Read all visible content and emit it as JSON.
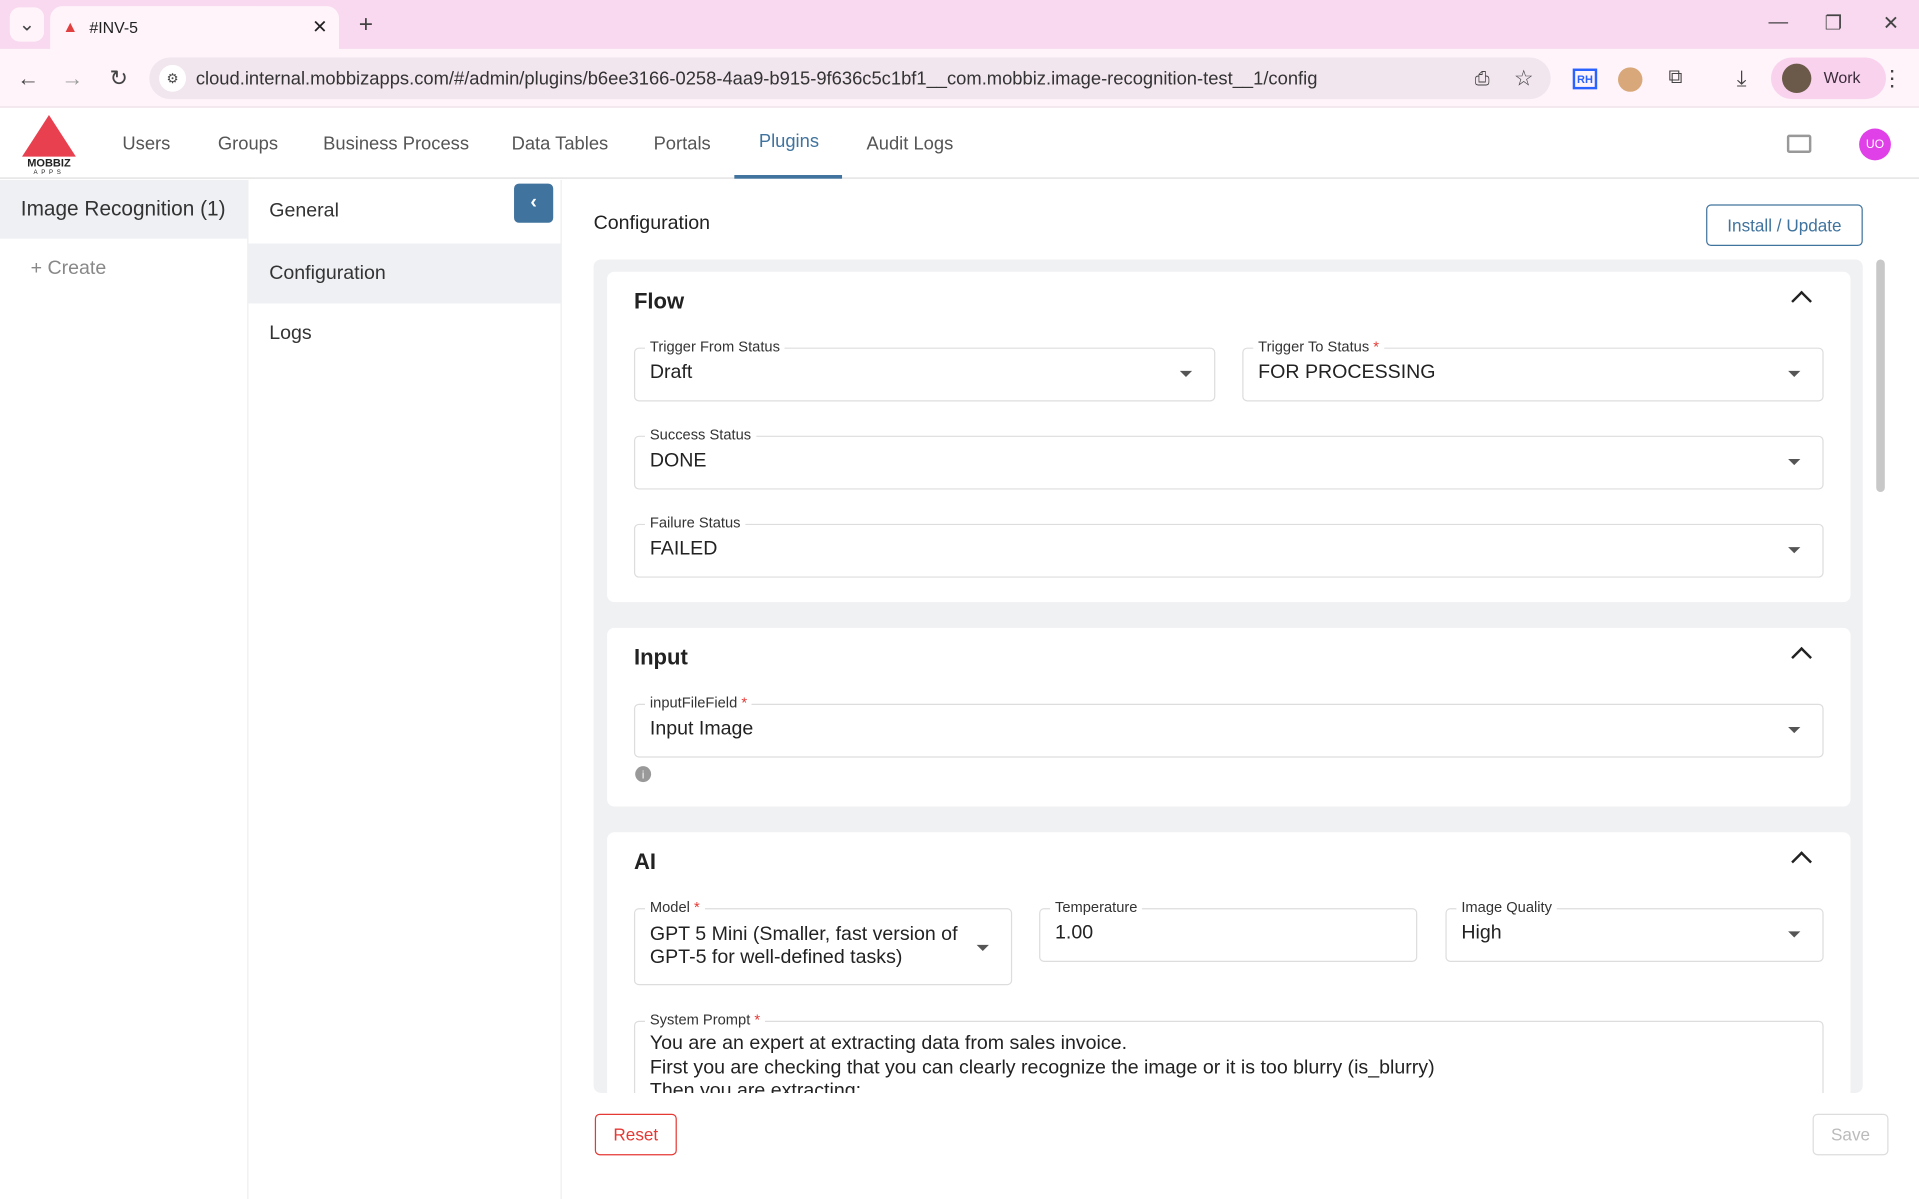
{
  "browser": {
    "tab_title": "#INV-5",
    "url": "cloud.internal.mobbizapps.com/#/admin/plugins/b6ee3166-0258-4aa9-b915-9f636c5c1bf1__com.mobbiz.image-recognition-test__1/config",
    "profile": "Work",
    "ext_label": "RH"
  },
  "app": {
    "logo_text": "MOBBIZ",
    "logo_sub": "APPS",
    "avatar": "UO",
    "nav": [
      "Users",
      "Groups",
      "Business Process",
      "Data Tables",
      "Portals",
      "Plugins",
      "Audit Logs"
    ]
  },
  "sidebar": {
    "plugin": "Image Recognition (1)",
    "create": "+ Create"
  },
  "subnav": [
    "General",
    "Configuration",
    "Logs"
  ],
  "main": {
    "title": "Configuration",
    "install": "Install / Update",
    "reset": "Reset",
    "save": "Save",
    "flow": {
      "title": "Flow",
      "trigger_from_label": "Trigger From Status",
      "trigger_from": "Draft",
      "trigger_to_label": "Trigger To Status",
      "trigger_to": "FOR PROCESSING",
      "success_label": "Success Status",
      "success": "DONE",
      "failure_label": "Failure Status",
      "failure": "FAILED"
    },
    "input": {
      "title": "Input",
      "field_label": "inputFileField",
      "field": "Input Image"
    },
    "ai": {
      "title": "AI",
      "model_label": "Model",
      "model": "GPT 5 Mini (Smaller, fast version of GPT-5 for well-defined tasks)",
      "temp_label": "Temperature",
      "temp": "1.00",
      "quality_label": "Image Quality",
      "quality": "High",
      "prompt_label": "System Prompt",
      "prompt": [
        "You are an expert at extracting data from sales invoice.",
        "First you are checking that you can clearly recognize the image or it is too blurry (is_blurry)",
        "Then you are extracting:"
      ]
    }
  }
}
